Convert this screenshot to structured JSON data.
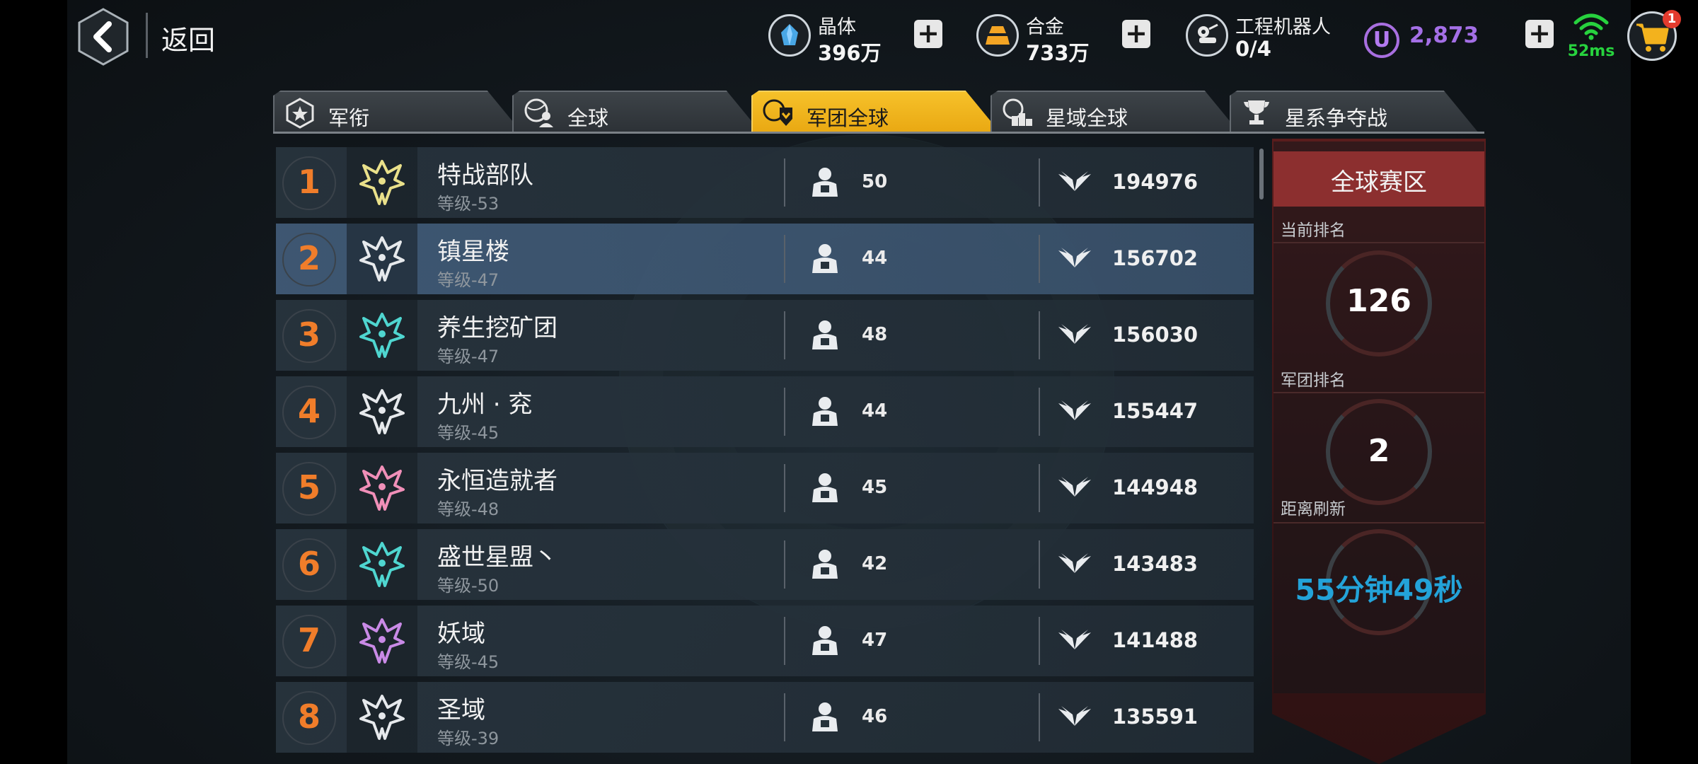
{
  "header": {
    "back_label": "返回",
    "resources": [
      {
        "name": "晶体",
        "value": "396万",
        "icon": "crystal-icon"
      },
      {
        "name": "合金",
        "value": "733万",
        "icon": "alloy-icon"
      },
      {
        "name": "工程机器人",
        "value": "0/4",
        "icon": "robot-icon"
      }
    ],
    "ucoin_symbol": "U",
    "ucoin_value": "2,873",
    "ping": "52ms",
    "cart_badge": "1"
  },
  "tabs": [
    {
      "label": "军衔",
      "icon": "rank-badge-icon",
      "active": false
    },
    {
      "label": "全球",
      "icon": "globe-person-icon",
      "active": false
    },
    {
      "label": "军团全球",
      "icon": "legion-globe-icon",
      "active": true
    },
    {
      "label": "星域全球",
      "icon": "star-domain-icon",
      "active": false
    },
    {
      "label": "星系争夺战",
      "icon": "trophy-icon",
      "active": false
    }
  ],
  "rankings": [
    {
      "rank": "1",
      "name": "特战部队",
      "level": "等级-53",
      "members": "50",
      "power": "194976",
      "emblem_color": "#e9e08a"
    },
    {
      "rank": "2",
      "name": "镇星楼",
      "level": "等级-47",
      "members": "44",
      "power": "156702",
      "emblem_color": "#e6e9ec"
    },
    {
      "rank": "3",
      "name": "养生挖矿团",
      "level": "等级-47",
      "members": "48",
      "power": "156030",
      "emblem_color": "#4fd6d0"
    },
    {
      "rank": "4",
      "name": "九州 · 兖",
      "level": "等级-45",
      "members": "44",
      "power": "155447",
      "emblem_color": "#e6e9ec"
    },
    {
      "rank": "5",
      "name": "永恒造就者",
      "level": "等级-48",
      "members": "45",
      "power": "144948",
      "emblem_color": "#f08fb8"
    },
    {
      "rank": "6",
      "name": "盛世星盟丶",
      "level": "等级-50",
      "members": "42",
      "power": "143483",
      "emblem_color": "#4fd6d0"
    },
    {
      "rank": "7",
      "name": "妖域",
      "level": "等级-45",
      "members": "47",
      "power": "141488",
      "emblem_color": "#c98ae6"
    },
    {
      "rank": "8",
      "name": "圣域",
      "level": "等级-39",
      "members": "46",
      "power": "135591",
      "emblem_color": "#e6e9ec"
    }
  ],
  "selected_rank": "2",
  "panel": {
    "title": "全球赛区",
    "current_rank_label": "当前排名",
    "current_rank": "126",
    "legion_rank_label": "军团排名",
    "legion_rank": "2",
    "refresh_label": "距离刷新",
    "refresh_time": "55分钟49秒"
  },
  "colors": {
    "accent_tab": "#f0b41c",
    "rank_number": "#f07d2a",
    "timer": "#23a3d9",
    "ucoin": "#a46fe6",
    "ping": "#27d23e",
    "panel": "#8c2f2f"
  }
}
